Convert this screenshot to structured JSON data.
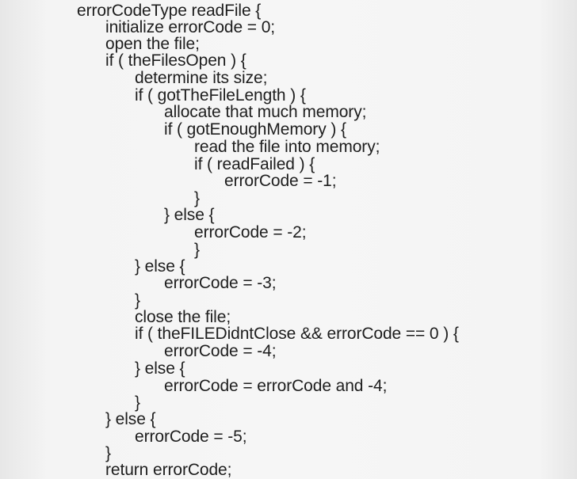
{
  "code": {
    "lines": [
      "errorCodeType readFile {",
      "initialize errorCode = 0;",
      "open the file;",
      "if ( theFilesOpen ) {",
      "determine its size;",
      "if ( gotTheFileLength ) {",
      "allocate that much memory;",
      "if ( gotEnoughMemory ) {",
      "read the file into memory;",
      "if ( readFailed ) {",
      "errorCode = -1;",
      "}",
      "} else {",
      "errorCode = -2;",
      "}",
      "} else {",
      "errorCode = -3;",
      "}",
      "close the file;",
      "if ( theFILEDidntClose && errorCode == 0 ) {",
      "errorCode = -4;",
      "} else {",
      "errorCode = errorCode and -4;",
      "}",
      "} else {",
      "errorCode = -5;",
      "}",
      "return errorCode;"
    ]
  }
}
